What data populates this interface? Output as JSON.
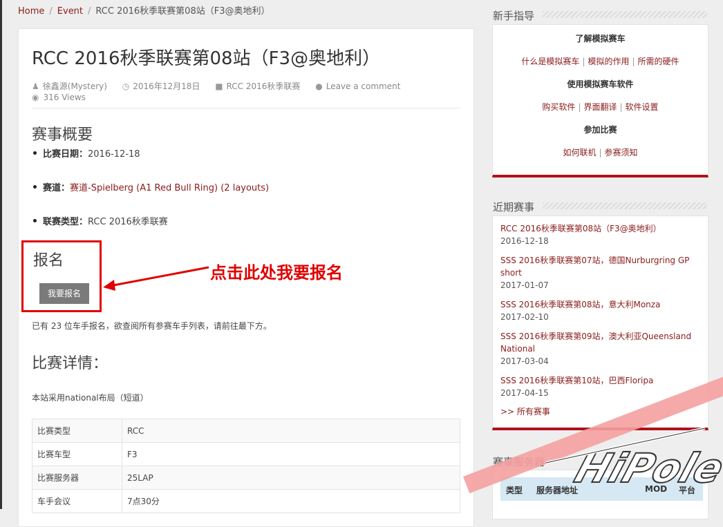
{
  "breadcrumb": {
    "home": "Home",
    "event": "Event",
    "current": "RCC 2016秋季联赛第08站（F3@奥地利）"
  },
  "post": {
    "title": "RCC 2016秋季联赛第08站（F3@奥地利）",
    "meta": {
      "author": "徐鑫源(Mystery)",
      "date": "2016年12月18日",
      "category": "RCC 2016秋季联赛",
      "comment": "Leave a comment",
      "views": "316 Views"
    },
    "overview_heading": "赛事概要",
    "summary": [
      {
        "label": "比赛日期：",
        "value": "2016-12-18",
        "is_link": false
      },
      {
        "label": "赛道：",
        "value": "赛道-Spielberg (A1 Red Bull Ring) (2 layouts)",
        "is_link": true
      },
      {
        "label": "联赛类型：",
        "value": "RCC 2016秋季联赛",
        "is_link": false
      }
    ],
    "signup_heading": "报名",
    "signup_button": "我要报名",
    "callout_text": "点击此处我要报名",
    "count_text": "已有 23 位车手报名，欲查阅所有参赛车手列表，请前往最下方。",
    "details_heading": "比赛详情：",
    "layout_text": "本站采用national布局（短道）",
    "details_table": [
      {
        "key": "比赛类型",
        "value": "RCC"
      },
      {
        "key": "比赛车型",
        "value": "F3"
      },
      {
        "key": "比赛服务器",
        "value": "25LAP"
      },
      {
        "key": "车手会议",
        "value": "7点30分"
      }
    ]
  },
  "sidebar": {
    "guide": {
      "title": "新手指导",
      "section1": "了解模拟赛车",
      "links1": [
        "什么是模拟赛车",
        "模拟的作用",
        "所需的硬件"
      ],
      "section2": "使用模拟赛车软件",
      "links2": [
        "购买软件",
        "界面翻译",
        "软件设置"
      ],
      "section3": "参加比赛",
      "links3": [
        "如何联机",
        "参赛须知"
      ]
    },
    "recent": {
      "title": "近期赛事",
      "events": [
        {
          "name": "RCC 2016秋季联赛第08站（F3@奥地利）",
          "date": "2016-12-18"
        },
        {
          "name": "SSS 2016秋季联赛第07站，德国Nurburgring GP short",
          "date": "2017-01-07"
        },
        {
          "name": "SSS 2016秋季联赛第08站，意大利Monza",
          "date": "2017-02-10"
        },
        {
          "name": "SSS 2016秋季联赛第09站，澳大利亚Queensland National",
          "date": "2017-03-04"
        },
        {
          "name": "SSS 2016秋季联赛第10站，巴西Floripa",
          "date": "2017-04-15"
        }
      ],
      "all_link": ">> 所有赛事"
    },
    "servers": {
      "title": "赛事服务器",
      "columns": [
        "类型",
        "服务器地址",
        "MOD",
        "平台"
      ]
    }
  },
  "watermark_text": "HiPole",
  "colors": {
    "accent": "#8b1a1a",
    "callout": "#e00000",
    "widget_border": "#b0111b",
    "server_header_bg": "#d5e8f3"
  }
}
